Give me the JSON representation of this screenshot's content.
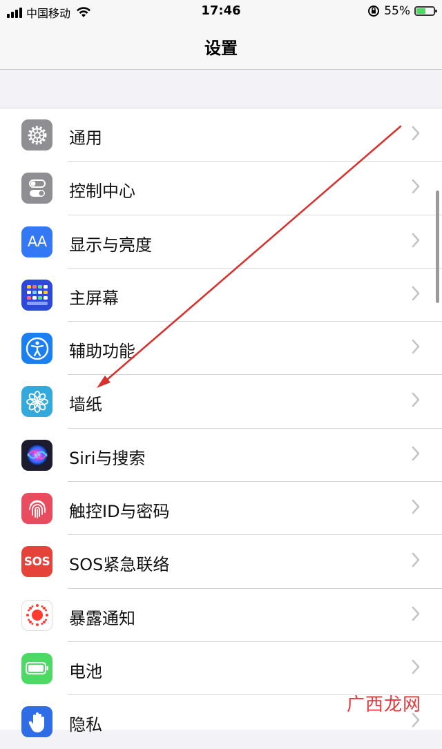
{
  "status_bar": {
    "carrier": "中国移动",
    "time": "17:46",
    "battery": "55%",
    "battery_level": 0.55
  },
  "nav": {
    "title": "设置"
  },
  "settings": [
    {
      "label": "通用",
      "icon": "gear-icon",
      "color": "#8e8e93"
    },
    {
      "label": "控制中心",
      "icon": "toggles-icon",
      "color": "#8e8e93"
    },
    {
      "label": "显示与亮度",
      "icon": "text-size-icon",
      "icon_text": "AA",
      "color": "#3478f6"
    },
    {
      "label": "主屏幕",
      "icon": "home-screen-grid-icon",
      "color": "#2c49d8"
    },
    {
      "label": "辅助功能",
      "icon": "accessibility-icon",
      "color": "#1a7ff0"
    },
    {
      "label": "墙纸",
      "icon": "flower-icon",
      "color": "#34aadc"
    },
    {
      "label": "Siri与搜索",
      "icon": "siri-icon",
      "color": "#1c1c2e"
    },
    {
      "label": "触控ID与密码",
      "icon": "fingerprint-icon",
      "color": "#ea4c5f"
    },
    {
      "label": "SOS紧急联络",
      "icon": "sos-icon",
      "icon_text": "SOS",
      "color": "#e5433a"
    },
    {
      "label": "暴露通知",
      "icon": "exposure-icon",
      "color": "#ffffff"
    },
    {
      "label": "电池",
      "icon": "battery-icon",
      "color": "#4cd964"
    },
    {
      "label": "隐私",
      "icon": "hand-icon",
      "color": "#2f6de6"
    }
  ],
  "watermark": "广西龙网"
}
